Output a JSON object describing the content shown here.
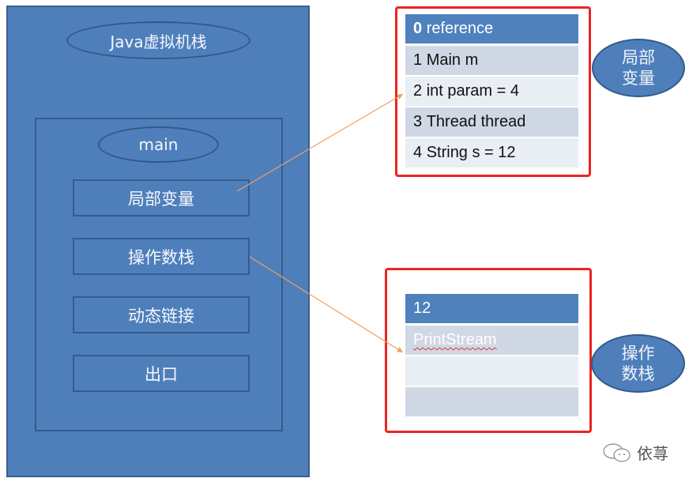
{
  "jvm_stack": {
    "title": "Java虚拟机栈",
    "frame": {
      "name": "main",
      "slots": [
        "局部变量",
        "操作数栈",
        "动态链接",
        "出口"
      ]
    }
  },
  "local_variables": {
    "label_line1": "局部",
    "label_line2": "变量",
    "rows": [
      {
        "index": "0",
        "text": "reference"
      },
      {
        "index": "1",
        "text": "Main m"
      },
      {
        "index": "2",
        "text": "int param = 4"
      },
      {
        "index": "3",
        "text": "Thread thread"
      },
      {
        "index": "4",
        "text": "String s = 12"
      }
    ]
  },
  "operand_stack": {
    "label_line1": "操作",
    "label_line2": "数栈",
    "rows": [
      "12",
      "PrintStream",
      "",
      ""
    ]
  },
  "watermark": {
    "icon": "wechat-icon",
    "text": "依荨"
  },
  "colors": {
    "stack_blue": "#4f7fbb",
    "highlight_red": "#ee2222",
    "arrow_orange": "#f0a060"
  }
}
